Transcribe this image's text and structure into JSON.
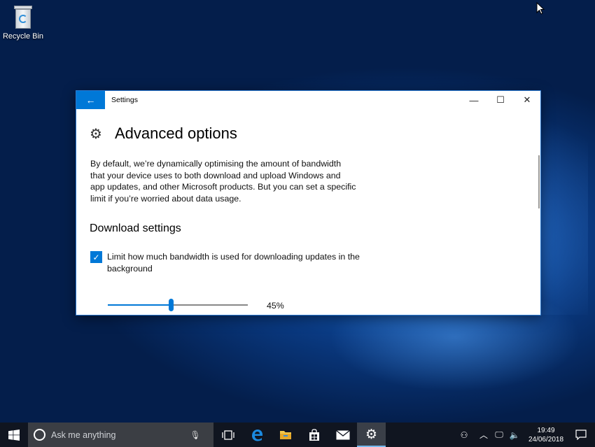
{
  "desktop": {
    "icons": [
      {
        "label": "Recycle Bin",
        "icon": "recycle-bin-icon"
      }
    ]
  },
  "window": {
    "title": "Settings",
    "back_icon": "←",
    "minimize_icon": "—",
    "maximize_icon": "☐",
    "close_icon": "✕",
    "page_title": "Advanced options",
    "description": "By default, we’re dynamically optimising the amount of bandwidth that your device uses to both download and upload Windows and app updates, and other Microsoft products. But you can set a specific limit if you’re worried about data usage.",
    "section_title": "Download settings",
    "limit_checkbox": {
      "label": "Limit how much bandwidth is used for downloading updates in the background",
      "checked": true
    },
    "slider": {
      "value": 45,
      "value_label": "45%"
    }
  },
  "taskbar": {
    "search_placeholder": "Ask me anything",
    "apps": [
      {
        "name": "task-view",
        "icon": "task-view-icon"
      },
      {
        "name": "edge",
        "icon": "edge-icon"
      },
      {
        "name": "file-explorer",
        "icon": "folder-icon"
      },
      {
        "name": "store",
        "icon": "store-icon"
      },
      {
        "name": "mail",
        "icon": "mail-icon"
      },
      {
        "name": "settings",
        "icon": "gear-icon",
        "active": true
      }
    ],
    "clock": {
      "time": "19:49",
      "date": "24/06/2018"
    }
  },
  "colors": {
    "accent": "#0078d7",
    "taskbar": "#101520",
    "search_box": "#3b3e44"
  }
}
